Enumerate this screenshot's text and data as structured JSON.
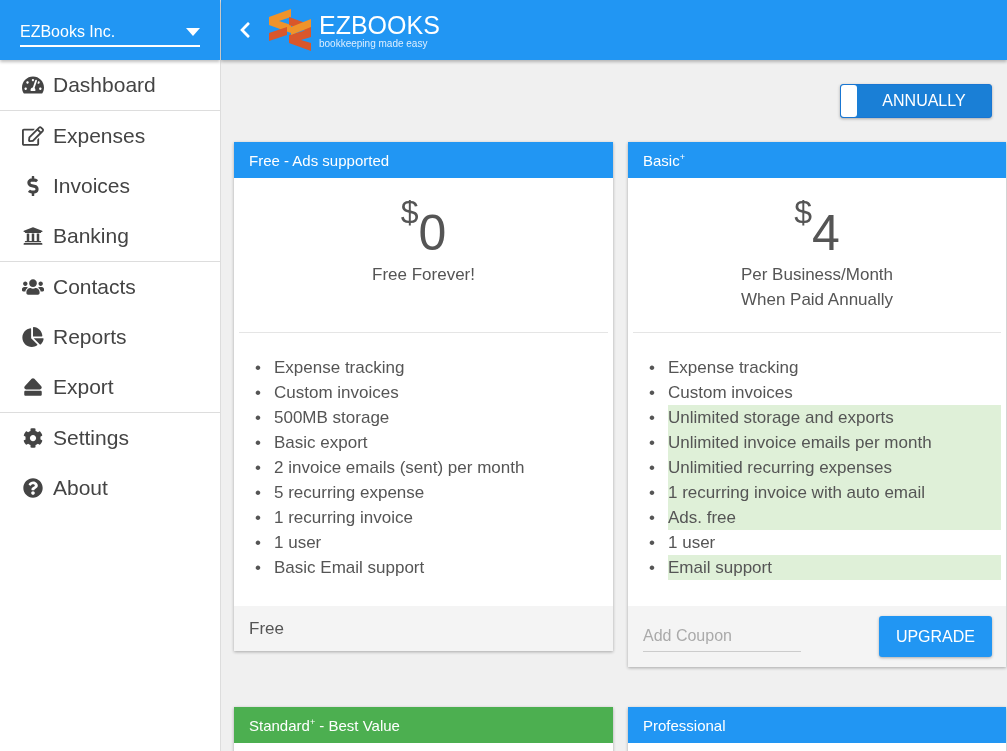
{
  "company_select": {
    "value": "EZBooks Inc."
  },
  "logo": {
    "name": "EZBOOKS",
    "tagline": "bookkeeping made easy"
  },
  "sidebar": {
    "groups": [
      {
        "items": [
          {
            "label": "Dashboard"
          }
        ]
      },
      {
        "items": [
          {
            "label": "Expenses"
          },
          {
            "label": "Invoices"
          },
          {
            "label": "Banking"
          }
        ]
      },
      {
        "items": [
          {
            "label": "Contacts"
          },
          {
            "label": "Reports"
          },
          {
            "label": "Export"
          }
        ]
      },
      {
        "items": [
          {
            "label": "Settings"
          },
          {
            "label": "About"
          }
        ]
      }
    ]
  },
  "billing_toggle": {
    "label": "ANNUALLY",
    "on": true
  },
  "plans": [
    {
      "title": "Free - Ads supported",
      "color": "#2196f3",
      "currency": "$",
      "amount": "0",
      "period": [
        "Free Forever!"
      ],
      "features": [
        {
          "marker": "•",
          "text": "Expense tracking",
          "highlighted": false
        },
        {
          "marker": "•",
          "text": "Custom invoices",
          "highlighted": false
        },
        {
          "marker": "•",
          "text": "500MB storage",
          "highlighted": false
        },
        {
          "marker": "•",
          "text": "Basic export",
          "highlighted": false
        },
        {
          "marker": "•",
          "text": "2 invoice emails (sent) per month",
          "highlighted": false
        },
        {
          "marker": "•",
          "text": "5 recurring expense",
          "highlighted": false
        },
        {
          "marker": "•",
          "text": "1 recurring invoice",
          "highlighted": false
        },
        {
          "marker": "•",
          "text": "1 user",
          "highlighted": false
        },
        {
          "marker": "•",
          "text": "Basic Email support",
          "highlighted": false
        }
      ],
      "footer": {
        "kind": "text",
        "text": "Free"
      }
    },
    {
      "title": "Basic$^{+}$",
      "color": "#2196f3",
      "currency": "$",
      "amount": "4",
      "period": [
        "Per Business/Month",
        "When Paid Annually"
      ],
      "features": [
        {
          "marker": "•",
          "text": "Expense tracking",
          "highlighted": false
        },
        {
          "marker": "•",
          "text": "Custom invoices",
          "highlighted": false
        },
        {
          "marker": "•",
          "text": "Unlimited storage and exports",
          "highlighted": true
        },
        {
          "marker": "•",
          "text": "Unlimited invoice emails per month",
          "highlighted": true
        },
        {
          "marker": "•",
          "text": "Unlimitied recurring expenses",
          "highlighted": true
        },
        {
          "marker": "•",
          "text": "1 recurring invoice with auto email",
          "highlighted": true
        },
        {
          "marker": "•",
          "text": "Ads. free",
          "highlighted": true
        },
        {
          "marker": "•",
          "text": "1 user",
          "highlighted": false
        },
        {
          "marker": "•",
          "text": "Email support",
          "highlighted": true
        }
      ],
      "footer": {
        "kind": "coupon",
        "placeholder": "Add Coupon",
        "button": "UPGRADE"
      }
    },
    {
      "title": "Standard$^{+}$ - Best Value",
      "color": "#4caf50"
    },
    {
      "title": "Professional",
      "color": "#2196f3"
    }
  ]
}
